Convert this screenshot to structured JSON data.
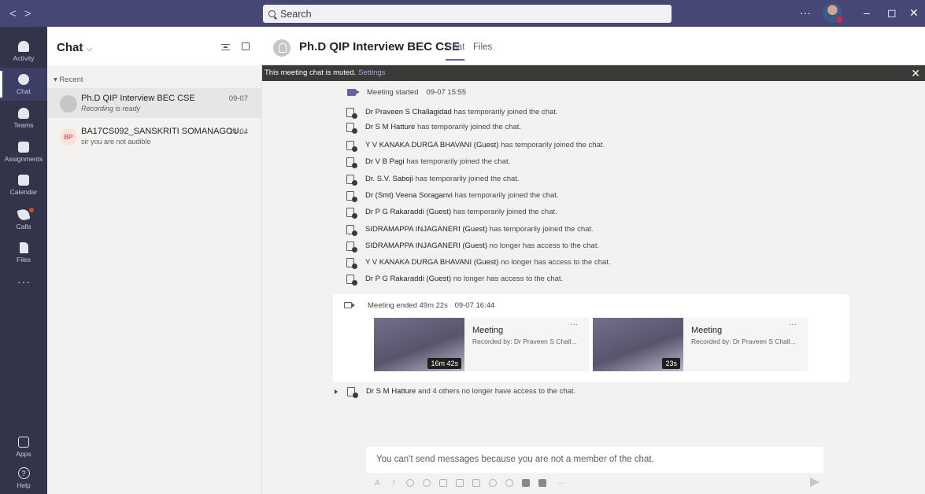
{
  "titlebar": {
    "back": "<",
    "forward": ">",
    "search_placeholder": "Search",
    "more": "···",
    "minimize": "–",
    "maximize": "◻",
    "close": "✕"
  },
  "appbar": {
    "items": [
      {
        "label": "Activity",
        "icon": "bell-icon"
      },
      {
        "label": "Chat",
        "icon": "chat-icon"
      },
      {
        "label": "Teams",
        "icon": "teams-icon"
      },
      {
        "label": "Assignments",
        "icon": "assignments-icon"
      },
      {
        "label": "Calendar",
        "icon": "calendar-icon"
      },
      {
        "label": "Calls",
        "icon": "phone-icon"
      },
      {
        "label": "Files",
        "icon": "file-icon"
      }
    ],
    "more": "···",
    "apps_label": "Apps",
    "help_label": "Help"
  },
  "chatlist": {
    "title": "Chat",
    "chevron": "⌵",
    "recent_label": "Recent",
    "chats": [
      {
        "name": "Ph.D QIP Interview BEC CSE",
        "subtitle": "Recording is ready",
        "date": "09-07"
      },
      {
        "name": "BA17CS092_SANSKRITI SOMANAGOU...",
        "subtitle": "sir you are not audible",
        "date": "24-04",
        "initials": "BP"
      }
    ]
  },
  "conversation": {
    "title": "Ph.D QIP Interview BEC CSE",
    "tabs": [
      "Chat",
      "Files"
    ],
    "banner_text": "This meeting chat is muted.",
    "banner_link": "Settings",
    "banner_close": "✕",
    "meeting_started": {
      "text": "Meeting started",
      "time": "09-07 15:55"
    },
    "events": [
      {
        "name": "Dr Praveen S Challagidad",
        "text": "has temporarily joined the chat."
      },
      {
        "name": "Dr S M Hatture",
        "text": "has temporarily joined the chat."
      },
      {
        "name": "Y V KANAKA DURGA BHAVANI (Guest)",
        "text": "has temporarily joined the chat."
      },
      {
        "name": "Dr V B Pagi",
        "text": "has temporarily joined the chat."
      },
      {
        "name": "Dr. S.V. Saboji",
        "text": "has temporarily joined the chat."
      },
      {
        "name": "Dr (Smt) Veena Soraganvi",
        "text": "has temporarily joined the chat."
      },
      {
        "name": "Dr P G Rakaraddi (Guest)",
        "text": "has temporarily joined the chat."
      },
      {
        "name": "SIDRAMAPPA INJAGANERI (Guest)",
        "text": "has temporarily joined the chat."
      },
      {
        "name": "SIDRAMAPPA INJAGANERI (Guest)",
        "text": "no longer has access to the chat."
      },
      {
        "name": "Y V KANAKA DURGA BHAVANI (Guest)",
        "text": "no longer has access to the chat."
      },
      {
        "name": "Dr P G Rakaraddi (Guest)",
        "text": "no longer has access to the chat."
      }
    ],
    "meeting_ended": {
      "text": "Meeting ended",
      "duration": "49m 22s",
      "time": "09-07 16:44"
    },
    "recordings": [
      {
        "title": "Meeting",
        "by": "Recorded by: Dr Praveen S Chall...",
        "duration": "16m 42s",
        "more": "···"
      },
      {
        "title": "Meeting",
        "by": "Recorded by: Dr Praveen S Chall...",
        "duration": "23s",
        "more": "···"
      }
    ],
    "collapsed": {
      "name": "Dr S M Hatture",
      "text": "and 4 others no longer have access to the chat."
    },
    "compose_notice": "You can't send messages because you are not a member of the chat.",
    "toolbar_format": "A",
    "toolbar_important": "!",
    "toolbar_more": "···"
  }
}
